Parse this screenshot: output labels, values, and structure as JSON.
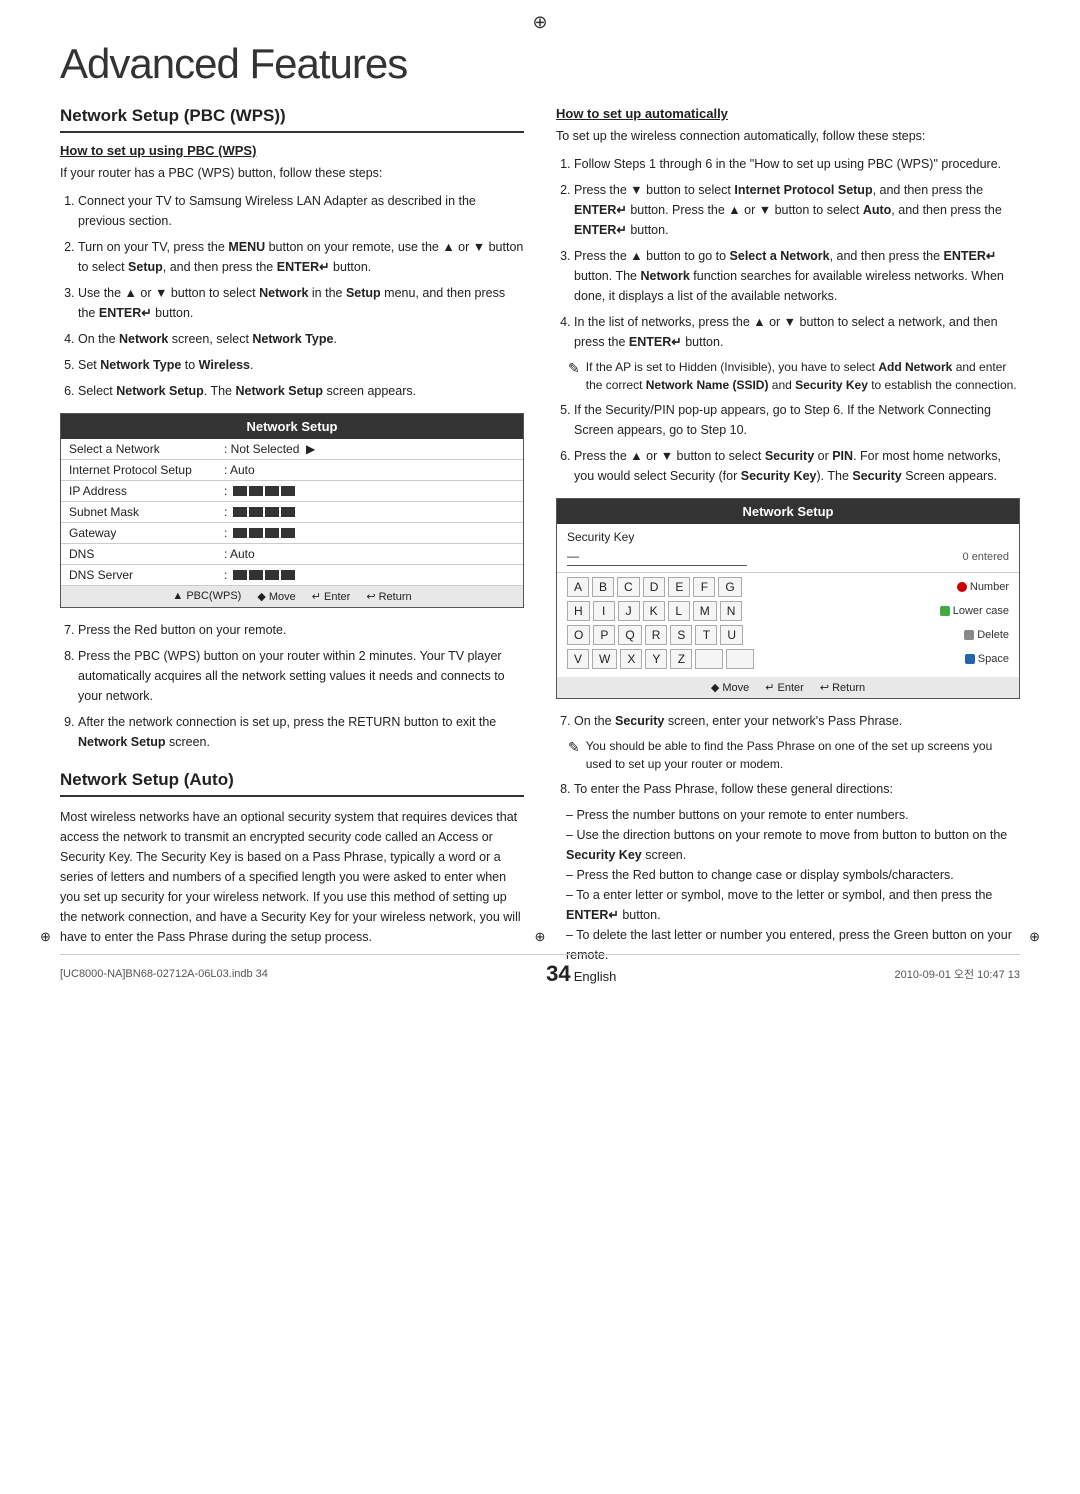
{
  "page": {
    "title": "Advanced Features",
    "corner_top": "⊕",
    "corner_bottom_left": "⊕",
    "corner_bottom_right": "⊕"
  },
  "left": {
    "section1_title": "Network Setup (PBC (WPS))",
    "subsection1_title": "How to set up using PBC (WPS)",
    "intro": "If your router has a PBC (WPS) button, follow these steps:",
    "steps": [
      "Connect your TV to Samsung Wireless LAN Adapter as described in the previous section.",
      "Turn on your TV, press the MENU button on your remote, use the ▲ or ▼ button to select Setup, and then press the ENTER↵ button.",
      "Use the ▲ or ▼ button to select Network in the Setup menu, and then press the ENTER↵ button.",
      "On the Network screen, select Network Type.",
      "Set Network Type to Wireless.",
      "Select Network Setup. The Network Setup screen appears."
    ],
    "network_setup": {
      "header": "Network Setup",
      "rows": [
        {
          "label": "Select a Network",
          "value": ": Not Selected",
          "arrow": true
        },
        {
          "label": "Internet Protocol Setup",
          "value": ": Auto"
        },
        {
          "label": "IP Address",
          "value": ":"
        },
        {
          "label": "Subnet Mask",
          "value": ":"
        },
        {
          "label": "Gateway",
          "value": ":"
        },
        {
          "label": "DNS",
          "value": ": Auto"
        },
        {
          "label": "DNS Server",
          "value": ":"
        }
      ],
      "footer": "▲ PBC(WPS)   ◆ Move   ↵ Enter   ↩ Return"
    },
    "step7": "Press the Red button on your remote.",
    "step8": "Press the PBC (WPS) button on your router within 2 minutes. Your TV player automatically acquires all the network setting values it needs and connects to your network.",
    "step9": "After the network connection is set up, press the RETURN button to exit the Network Setup screen.",
    "section2_title": "Network Setup (Auto)",
    "section2_body": "Most wireless networks have an optional security system that requires devices that access the network to transmit an encrypted security code called an Access or Security Key. The Security Key is based on a Pass Phrase, typically a word or a series of letters and numbers of a specified length you were asked to enter when you set up security for your wireless network. If you use this method of setting up the network connection, and have a Security Key for your wireless network, you will have to enter the Pass Phrase during the setup process."
  },
  "right": {
    "subsection_title": "How to set up automatically",
    "intro": "To set up the wireless connection automatically, follow these steps:",
    "steps": [
      "Follow Steps 1 through 6 in the \"How to set up using PBC (WPS)\" procedure.",
      "Press the ▼ button to select Internet Protocol Setup, and then press the ENTER↵ button. Press the ▲ or ▼ button to select Auto, and then press the ENTER↵ button.",
      "Press the ▲ button to go to Select a Network, and then press the ENTER↵ button. The Network function searches for available wireless networks. When done, it displays a list of the available networks.",
      "In the list of networks, press the ▲ or ▼ button to select a network, and then press the ENTER↵ button."
    ],
    "note1": "If the AP is set to Hidden (Invisible), you have to select Add Network and enter the correct Network Name (SSID) and Security Key to establish the connection.",
    "step5": "If the Security/PIN pop-up appears, go to Step 6. If the Network Connecting Screen appears, go to Step 10.",
    "step6": "Press the ▲ or ▼ button to select Security or PIN. For most home networks, you would select Security (for Security Key). The Security Screen appears.",
    "security_setup": {
      "header": "Network Setup",
      "key_label": "Security Key",
      "key_value": "—",
      "entered": "0 entered",
      "keys_row1": [
        "A",
        "B",
        "C",
        "D",
        "E",
        "F",
        "G"
      ],
      "keys_row2": [
        "H",
        "I",
        "J",
        "K",
        "L",
        "M",
        "N"
      ],
      "keys_row3": [
        "O",
        "P",
        "Q",
        "R",
        "S",
        "T",
        "U"
      ],
      "keys_row4": [
        "V",
        "W",
        "X",
        "Y",
        "Z"
      ],
      "label1": "Number",
      "label2": "Lower case",
      "label3": "Delete",
      "label4": "Space",
      "footer": "◆ Move   ↵ Enter   ↩ Return"
    },
    "step7_right": "On the Security screen, enter your network's Pass Phrase.",
    "note2": "You should be able to find the Pass Phrase on one of the set up screens you used to set up your router or modem.",
    "step8_right": "To enter the Pass Phrase, follow these general directions:",
    "directions": [
      "Press the number buttons on your remote to enter numbers.",
      "Use the direction buttons on your remote to move from button to button on the Security Key screen.",
      "Press the Red button to change case or display symbols/characters.",
      "To a enter letter or symbol, move to the letter or symbol, and then press the ENTER↵ button.",
      "To delete the last letter or number you entered, press the Green button on your remote."
    ]
  },
  "footer": {
    "page_num": "34",
    "page_label": "English",
    "file_info": "[UC8000-NA]BN68-02712A-06L03.indb  34",
    "date_info": "2010-09-01  오전  10:47  13"
  }
}
